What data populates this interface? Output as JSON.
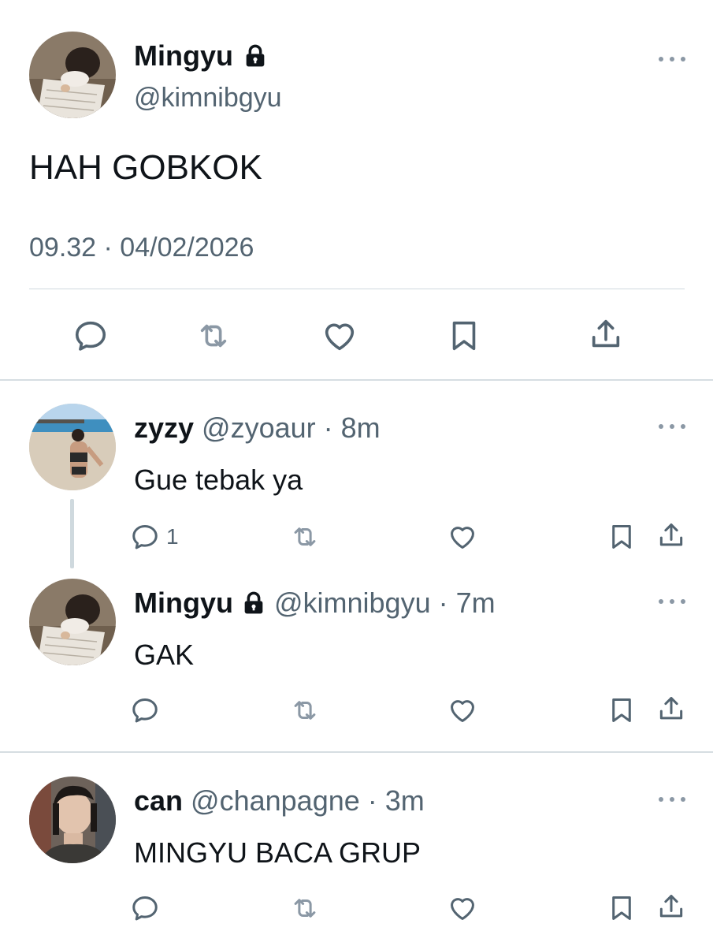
{
  "main_tweet": {
    "name": "Mingyu",
    "handle": "@kimnibgyu",
    "text": "HAH GOBKOK",
    "timestamp": "09.32 · 04/02/2026",
    "actions": [
      "reply-icon",
      "retweet-icon",
      "like-icon",
      "bookmark-icon",
      "share-icon"
    ]
  },
  "replies": [
    {
      "name": "zyzy",
      "handle": "@zyoaur",
      "time": "· 8m",
      "text": "Gue tebak ya",
      "reply_count": "1",
      "locked": false
    },
    {
      "name": "Mingyu",
      "handle": "@kimnibgyu",
      "time": "· 7m",
      "text": "GAK",
      "reply_count": "",
      "locked": true
    },
    {
      "name": "can",
      "handle": "@chanpagne",
      "time": "· 3m",
      "text": "MINGYU BACA GRUP",
      "reply_count": "",
      "locked": false
    }
  ],
  "colors": {
    "text_primary": "#0f1419",
    "text_secondary": "#536471",
    "divider": "#cfd9de"
  }
}
